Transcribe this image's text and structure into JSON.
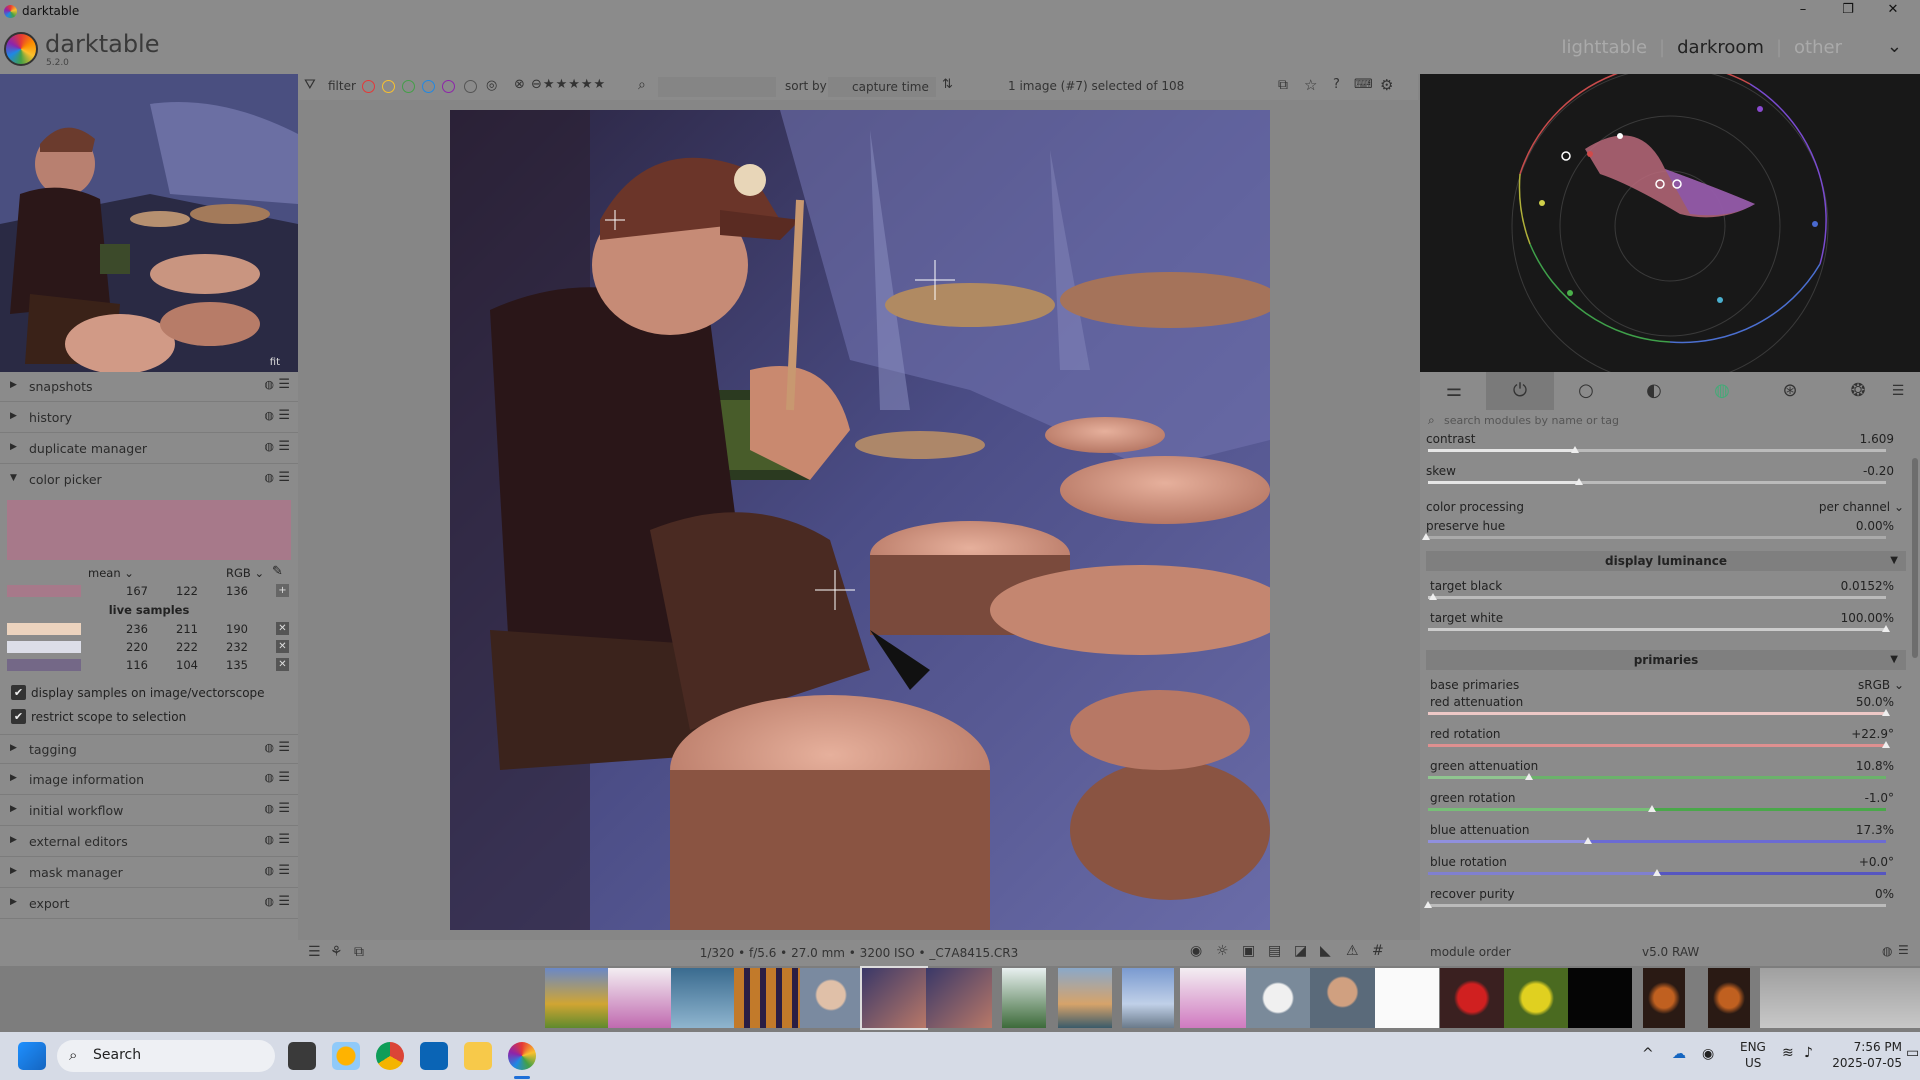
{
  "window": {
    "title": "darktable",
    "controls": [
      "–",
      "❐",
      "✕"
    ]
  },
  "header": {
    "brand": "darktable",
    "version": "5.2.0",
    "views": [
      "lighttable",
      "darkroom",
      "other"
    ],
    "active_view": "darkroom",
    "menu_icon": "chevron-down-icon"
  },
  "left": {
    "thumb_label": "fit",
    "modules_top": [
      {
        "label": "snapshots",
        "expanded": false
      },
      {
        "label": "history",
        "expanded": false
      },
      {
        "label": "duplicate manager",
        "expanded": false
      },
      {
        "label": "color picker",
        "expanded": true
      }
    ],
    "color_picker": {
      "swatch_color": "#a7798a",
      "stat": "mean",
      "model": "RGB",
      "mean": {
        "color": "#a7798a",
        "r": "167",
        "g": "122",
        "b": "136"
      },
      "live_samples_label": "live samples",
      "samples": [
        {
          "color": "#ecd3be",
          "r": "236",
          "g": "211",
          "b": "190"
        },
        {
          "color": "#dcdee8",
          "r": "220",
          "g": "222",
          "b": "232"
        },
        {
          "color": "#746887",
          "r": "116",
          "g": "104",
          "b": "135"
        }
      ],
      "display_samples": "display samples on image/vectorscope",
      "restrict_scope": "restrict scope to selection"
    },
    "modules_bottom": [
      {
        "label": "tagging"
      },
      {
        "label": "image information"
      },
      {
        "label": "initial workflow"
      },
      {
        "label": "external editors"
      },
      {
        "label": "mask manager"
      },
      {
        "label": "export"
      }
    ]
  },
  "toolbar": {
    "filter_label": "filter",
    "color_labels": [
      "#e53935",
      "#fbc02d",
      "#43a047",
      "#1e88e5",
      "#8e24aa"
    ],
    "sort_label": "sort by",
    "sort_value": "capture time",
    "selection_info": "1 image (#7) selected of 108"
  },
  "bottombar": {
    "exif": "1/320 • f/5.6 • 27.0 mm • 3200 ISO • _C7A8415.CR3"
  },
  "right": {
    "search_placeholder": "search modules by name or tag",
    "sliders_a": [
      {
        "name": "contrast",
        "value": "1.609",
        "pos": 0.32
      },
      {
        "name": "skew",
        "value": "-0.20",
        "pos": 0.33
      }
    ],
    "color_processing": {
      "name": "color processing",
      "value": "per channel"
    },
    "preserve_hue": {
      "name": "preserve hue",
      "value": "0.00%",
      "pos": 0.0
    },
    "display_luminance_label": "display luminance",
    "sliders_b": [
      {
        "name": "target black",
        "value": "0.0152%",
        "pos": 0.01
      },
      {
        "name": "target white",
        "value": "100.00%",
        "pos": 1.0
      }
    ],
    "primaries_label": "primaries",
    "base_primaries": {
      "name": "base primaries",
      "value": "sRGB"
    },
    "sliders_c": [
      {
        "name": "red attenuation",
        "value": "50.0%",
        "pos": 1.0,
        "color": "#e9b7b4"
      },
      {
        "name": "red rotation",
        "value": "+22.9°",
        "pos": 1.0,
        "color": "#d36b6b"
      },
      {
        "name": "green attenuation",
        "value": "10.8%",
        "pos": 0.22,
        "color": "#6bb26b"
      },
      {
        "name": "green rotation",
        "value": "-1.0°",
        "pos": 0.49,
        "color": "#4aa84a"
      },
      {
        "name": "blue attenuation",
        "value": "17.3%",
        "pos": 0.35,
        "color": "#6b6bd3"
      },
      {
        "name": "blue rotation",
        "value": "+0.0°",
        "pos": 0.5,
        "color": "#5656c0"
      },
      {
        "name": "recover purity",
        "value": "0%",
        "pos": 0.0,
        "color": "#bbbbbb"
      }
    ],
    "module_order_label": "module order",
    "module_order_value": "v5.0 RAW"
  },
  "taskbar": {
    "search": "Search",
    "lang1": "ENG",
    "lang2": "US",
    "time": "7:56 PM",
    "date": "2025-07-05"
  }
}
